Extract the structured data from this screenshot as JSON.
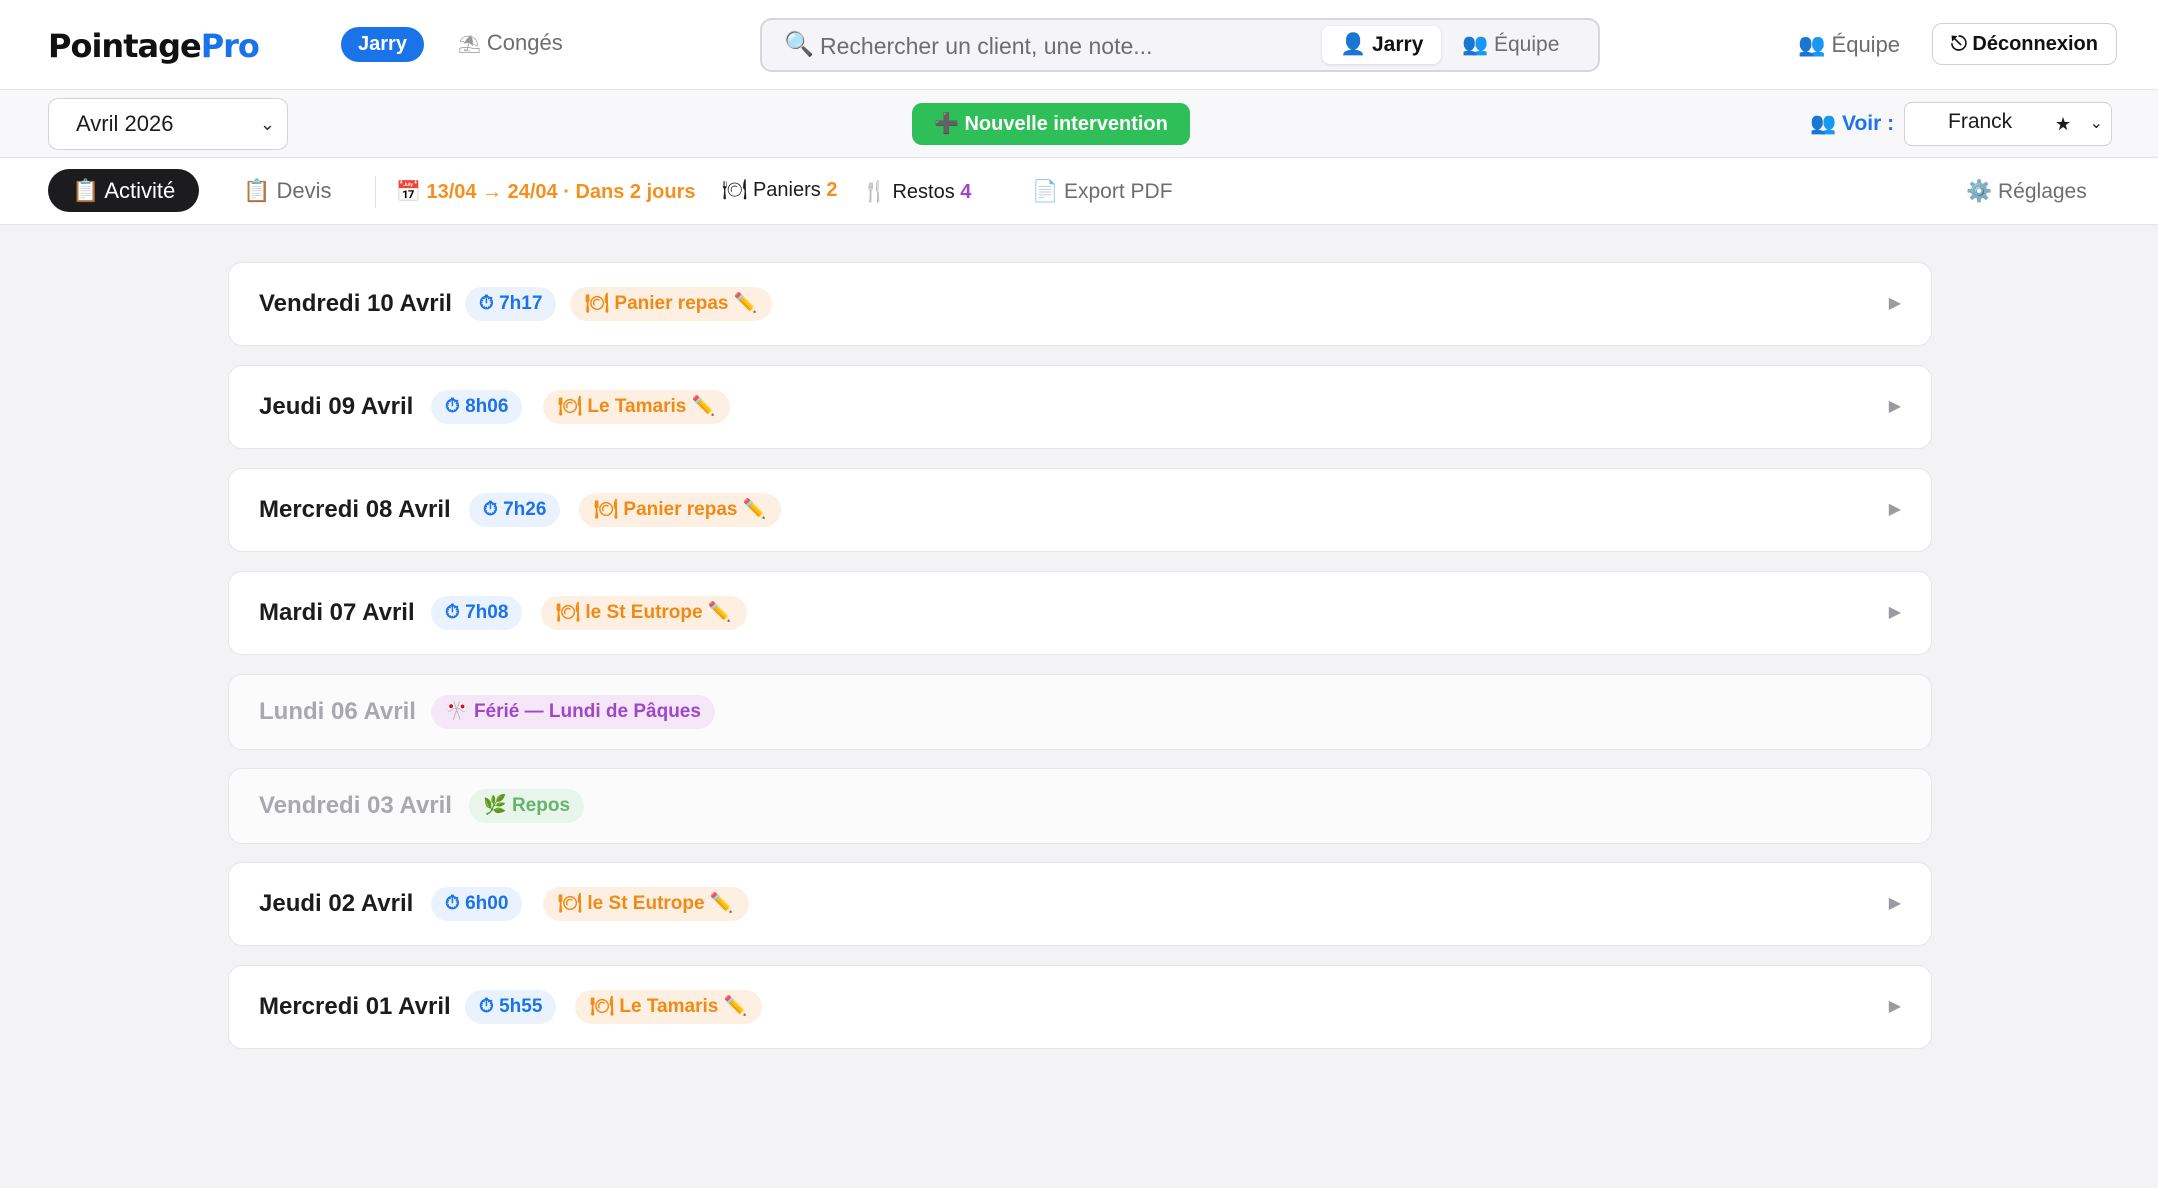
{
  "header": {
    "logo_part1": "Pointage",
    "logo_part2": "Pro",
    "user_badge": "Jarry",
    "conges_label": "Congés",
    "search_placeholder": "Rechercher un client, une note...",
    "search_scope_self": "Jarry",
    "search_scope_team": "Équipe",
    "team_link": "Équipe",
    "logout_label": "Déconnexion"
  },
  "toolbar": {
    "month_value": "Avril 2026",
    "new_intervention_label": "Nouvelle intervention",
    "voir_label": "Voir :",
    "voir_value": "Franck",
    "voir_star": "★"
  },
  "tabs": {
    "activite": "Activité",
    "devis": "Devis",
    "conge_range": "13/04 → 24/04 · Dans 2 jours",
    "paniers_label": "Paniers",
    "paniers_count": "2",
    "restos_label": "Restos",
    "restos_count": "4",
    "export_label": "Export PDF",
    "reglages_label": "Réglages"
  },
  "days": [
    {
      "title": "Vendredi 10 Avril",
      "kind": "work",
      "hours": "7h17",
      "meal": "Panier repas"
    },
    {
      "title": "Jeudi 09 Avril",
      "kind": "work",
      "hours": "8h06",
      "meal": "Le Tamaris"
    },
    {
      "title": "Mercredi 08 Avril",
      "kind": "work",
      "hours": "7h26",
      "meal": "Panier repas"
    },
    {
      "title": "Mardi 07 Avril",
      "kind": "work",
      "hours": "7h08",
      "meal": "le St Eutrope"
    },
    {
      "title": "Lundi 06 Avril",
      "kind": "holiday",
      "label": "Férié — Lundi de Pâques"
    },
    {
      "title": "Vendredi 03 Avril",
      "kind": "rest",
      "label": "Repos"
    },
    {
      "title": "Jeudi 02 Avril",
      "kind": "work",
      "hours": "6h00",
      "meal": "le St Eutrope"
    },
    {
      "title": "Mercredi 01 Avril",
      "kind": "work",
      "hours": "5h55",
      "meal": "Le Tamaris"
    }
  ],
  "colors": {
    "accent_blue": "#1a73e8",
    "accent_green": "#2fbf58",
    "meal_orange": "#f08a14",
    "holiday_purple": "#a047c7",
    "rest_green": "#66b36d"
  }
}
